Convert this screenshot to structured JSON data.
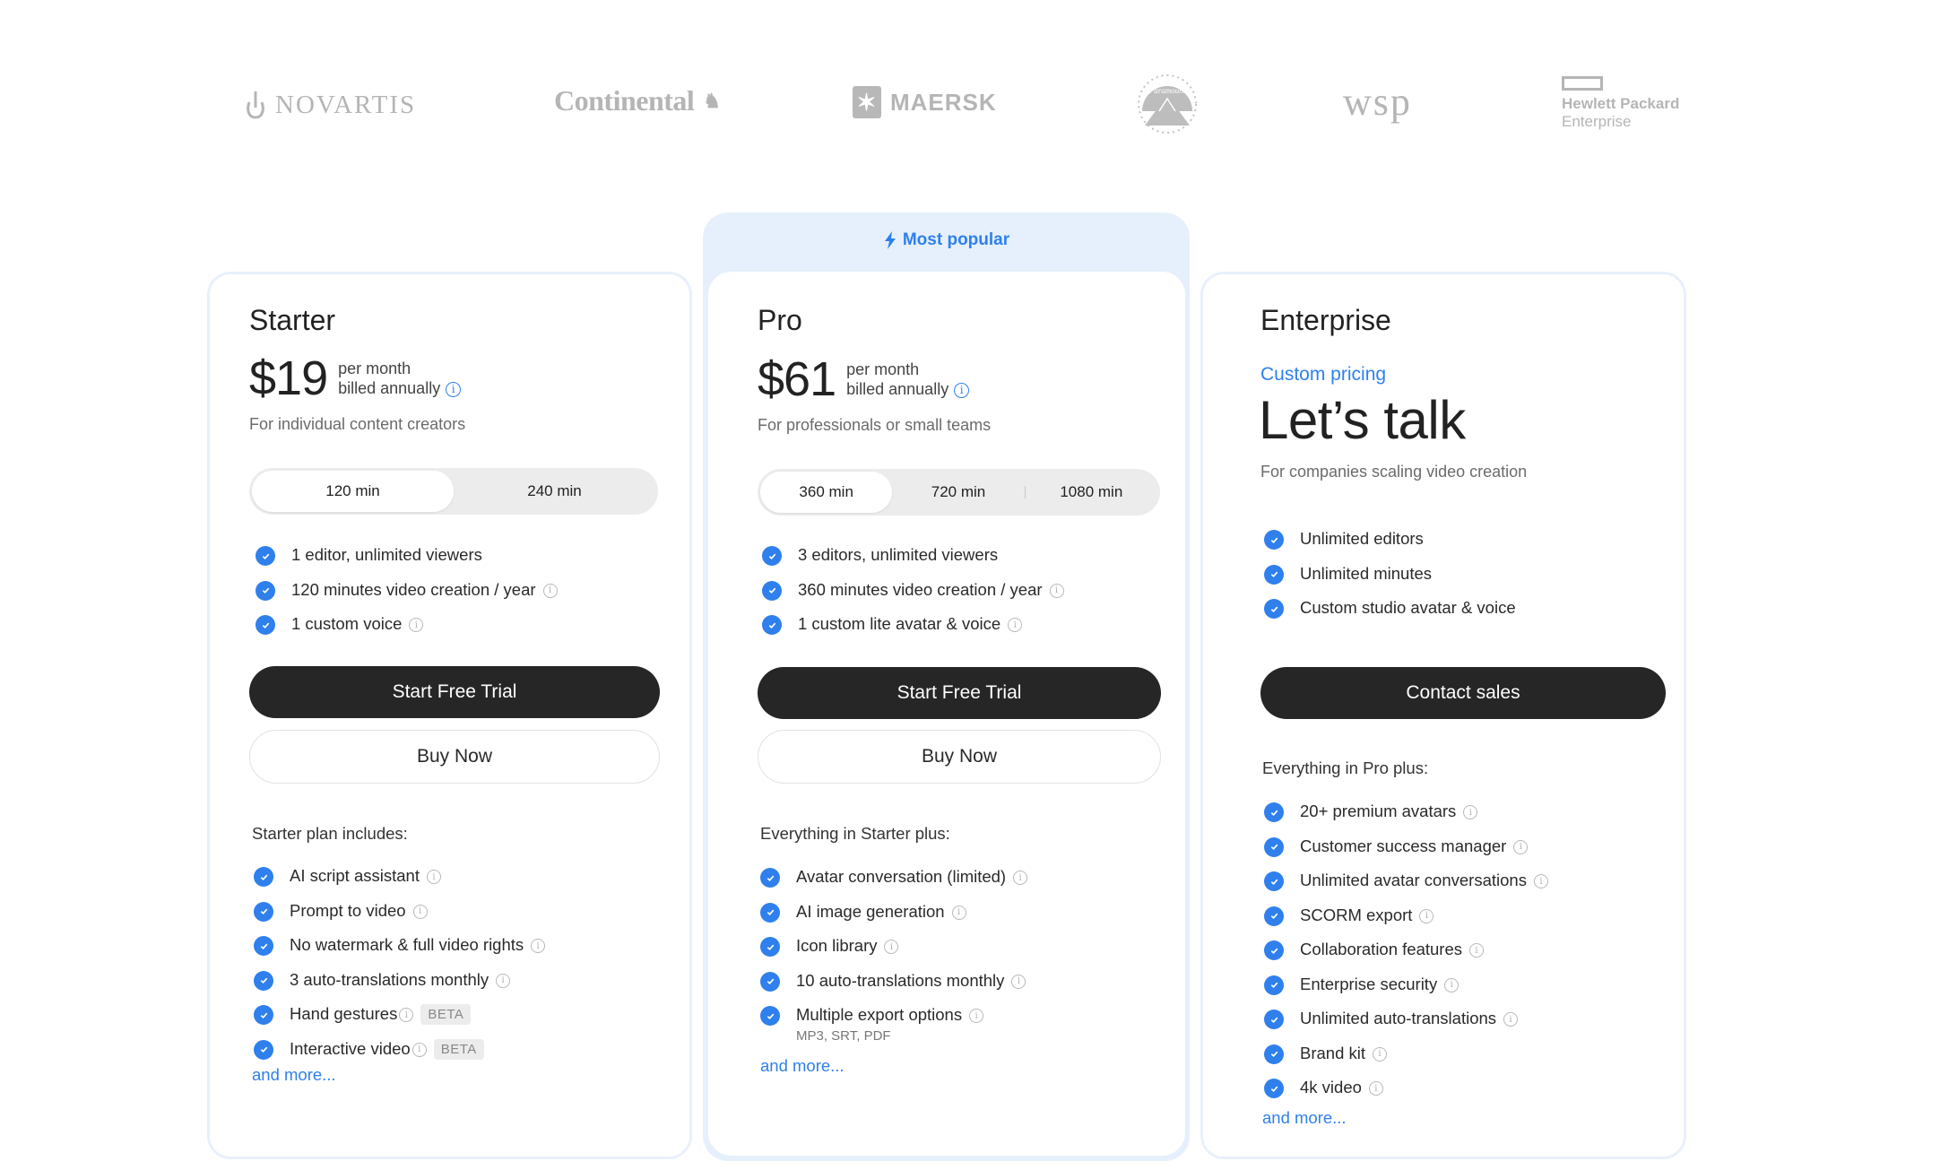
{
  "logos": [
    {
      "name": "NOVARTIS"
    },
    {
      "name": "Continental"
    },
    {
      "name": "MAERSK"
    },
    {
      "name": "Paramount"
    },
    {
      "name": "wsp"
    },
    {
      "name": "Hewlett Packard",
      "sub": "Enterprise"
    }
  ],
  "badge": {
    "label": "Most popular",
    "icon": "bolt-icon"
  },
  "colors": {
    "accent": "#2f80ed",
    "button_dark": "#262626",
    "popular_bg": "#e6f0fc",
    "card_border": "#e8f0fb"
  },
  "plans": {
    "starter": {
      "name": "Starter",
      "price": "$19",
      "period": "per month",
      "billing": "billed annually",
      "description": "For individual content creators",
      "toggle": [
        {
          "label": "120 min",
          "active": true
        },
        {
          "label": "240 min",
          "active": false
        }
      ],
      "highlights": [
        {
          "text": "1 editor, unlimited viewers",
          "info": false
        },
        {
          "text": "120 minutes video creation / year",
          "info": true
        },
        {
          "text": "1 custom voice",
          "info": true
        }
      ],
      "primary_cta": "Start Free Trial",
      "secondary_cta": "Buy Now",
      "includes_label": "Starter plan includes:",
      "features": [
        {
          "text": "AI script assistant",
          "info": true
        },
        {
          "text": "Prompt to video",
          "info": true
        },
        {
          "text": "No watermark & full video rights",
          "info": true
        },
        {
          "text": "3 auto-translations monthly",
          "info": true
        },
        {
          "text": "Hand gestures",
          "info": true,
          "badge": "BETA"
        },
        {
          "text": "Interactive video",
          "info": true,
          "badge": "BETA"
        }
      ],
      "more_link": "and more..."
    },
    "pro": {
      "name": "Pro",
      "price": "$61",
      "period": "per month",
      "billing": "billed annually",
      "description": "For professionals or small teams",
      "toggle": [
        {
          "label": "360 min",
          "active": true
        },
        {
          "label": "720 min",
          "active": false
        },
        {
          "label": "1080 min",
          "active": false
        }
      ],
      "highlights": [
        {
          "text": "3 editors, unlimited viewers",
          "info": false
        },
        {
          "text": "360 minutes video creation / year",
          "info": true
        },
        {
          "text": "1 custom lite avatar & voice",
          "info": true
        }
      ],
      "primary_cta": "Start Free Trial",
      "secondary_cta": "Buy Now",
      "includes_label": "Everything in Starter plus:",
      "features": [
        {
          "text": "Avatar conversation (limited)",
          "info": true
        },
        {
          "text": "AI image generation",
          "info": true
        },
        {
          "text": "Icon library",
          "info": true
        },
        {
          "text": "10 auto-translations monthly",
          "info": true
        },
        {
          "text": "Multiple export options",
          "info": true,
          "sub": "MP3, SRT, PDF"
        }
      ],
      "more_link": "and more..."
    },
    "enterprise": {
      "name": "Enterprise",
      "custom_pricing": "Custom pricing",
      "headline": "Let’s talk",
      "description": "For companies scaling video creation",
      "highlights": [
        {
          "text": "Unlimited editors",
          "info": false
        },
        {
          "text": "Unlimited minutes",
          "info": false
        },
        {
          "text": "Custom studio avatar & voice",
          "info": false
        }
      ],
      "primary_cta": "Contact sales",
      "includes_label": "Everything in Pro plus:",
      "features": [
        {
          "text": "20+ premium avatars",
          "info": true
        },
        {
          "text": "Customer success manager",
          "info": true
        },
        {
          "text": "Unlimited avatar conversations",
          "info": true
        },
        {
          "text": "SCORM export",
          "info": true
        },
        {
          "text": "Collaboration features",
          "info": true
        },
        {
          "text": "Enterprise security",
          "info": true
        },
        {
          "text": "Unlimited auto-translations",
          "info": true
        },
        {
          "text": "Brand kit",
          "info": true
        },
        {
          "text": "4k video",
          "info": true
        }
      ],
      "more_link": "and more..."
    }
  }
}
